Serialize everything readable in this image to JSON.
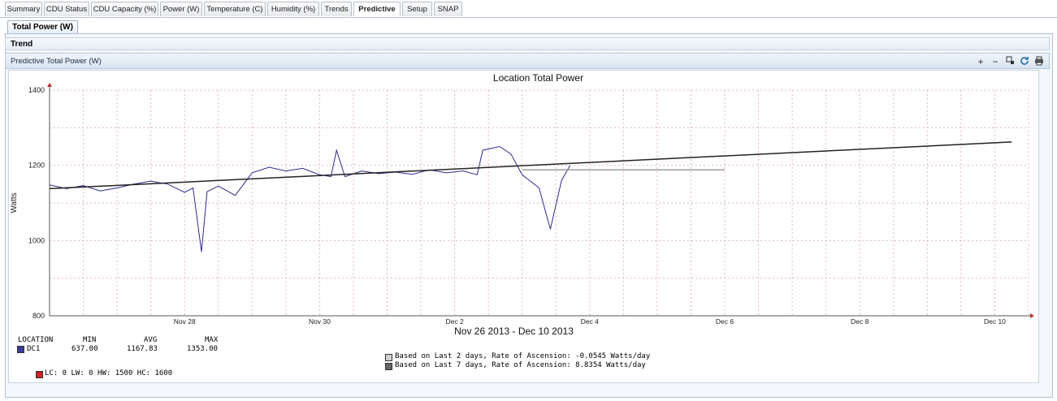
{
  "tabs": [
    {
      "label": "Summary",
      "active": false
    },
    {
      "label": "CDU Status",
      "active": false
    },
    {
      "label": "CDU Capacity (%)",
      "active": false
    },
    {
      "label": "Power (W)",
      "active": false
    },
    {
      "label": "Temperature (C)",
      "active": false
    },
    {
      "label": "Humidity (%)",
      "active": false
    },
    {
      "label": "Trends",
      "active": false
    },
    {
      "label": "Predictive",
      "active": true
    },
    {
      "label": "Setup",
      "active": false
    },
    {
      "label": "SNAP",
      "active": false
    }
  ],
  "subtab": {
    "label": "Total Power (W)"
  },
  "section": {
    "title": "Trend"
  },
  "panel": {
    "title": "Predictive Total Power (W)",
    "toolbar": [
      "zoom-in-icon",
      "zoom-out-icon",
      "zoom-fit-icon",
      "refresh-icon",
      "print-icon"
    ]
  },
  "chart_data": {
    "type": "line",
    "title": "Location Total Power",
    "xlabel": "Nov 26 2013 - Dec 10 2013",
    "ylabel": "Watts",
    "ylim": [
      800,
      1400
    ],
    "yticks": [
      "800",
      "1000",
      "1200",
      "1400"
    ],
    "xlim": [
      "2013-11-26",
      "2013-12-10"
    ],
    "xticks": [
      "Nov 28",
      "Nov 30",
      "Dec 2",
      "Dec 4",
      "Dec 6",
      "Dec 8",
      "Dec 10"
    ],
    "grid": true,
    "series": [
      {
        "name": "DC1",
        "color": "#2b2b8c",
        "points": [
          [
            "2013-11-26T00:00",
            1148
          ],
          [
            "2013-11-26T06:00",
            1138
          ],
          [
            "2013-11-26T12:00",
            1146
          ],
          [
            "2013-11-26T18:00",
            1132
          ],
          [
            "2013-11-27T00:00",
            1140
          ],
          [
            "2013-11-27T06:00",
            1150
          ],
          [
            "2013-11-27T12:00",
            1158
          ],
          [
            "2013-11-27T18:00",
            1150
          ],
          [
            "2013-11-28T00:00",
            1128
          ],
          [
            "2013-11-28T03:00",
            1140
          ],
          [
            "2013-11-28T06:00",
            970
          ],
          [
            "2013-11-28T08:00",
            1130
          ],
          [
            "2013-11-28T12:00",
            1145
          ],
          [
            "2013-11-28T18:00",
            1120
          ],
          [
            "2013-11-29T00:00",
            1180
          ],
          [
            "2013-11-29T06:00",
            1195
          ],
          [
            "2013-11-29T12:00",
            1185
          ],
          [
            "2013-11-29T18:00",
            1192
          ],
          [
            "2013-11-30T00:00",
            1175
          ],
          [
            "2013-11-30T04:00",
            1170
          ],
          [
            "2013-11-30T06:00",
            1240
          ],
          [
            "2013-11-30T09:00",
            1170
          ],
          [
            "2013-11-30T15:00",
            1185
          ],
          [
            "2013-11-30T21:00",
            1178
          ],
          [
            "2013-12-01T03:00",
            1182
          ],
          [
            "2013-12-01T09:00",
            1176
          ],
          [
            "2013-12-01T15:00",
            1188
          ],
          [
            "2013-12-01T21:00",
            1180
          ],
          [
            "2013-12-02T03:00",
            1185
          ],
          [
            "2013-12-02T08:00",
            1175
          ],
          [
            "2013-12-02T10:00",
            1240
          ],
          [
            "2013-12-02T16:00",
            1250
          ],
          [
            "2013-12-02T20:00",
            1230
          ],
          [
            "2013-12-03T00:00",
            1175
          ],
          [
            "2013-12-03T06:00",
            1140
          ],
          [
            "2013-12-03T10:00",
            1030
          ],
          [
            "2013-12-03T14:00",
            1160
          ],
          [
            "2013-12-03T17:00",
            1200
          ]
        ]
      },
      {
        "name": "Based on Last 2 days",
        "color": "#9a9a9a",
        "points": [
          [
            "2013-12-03T00:00",
            1188
          ],
          [
            "2013-12-06T00:00",
            1188
          ]
        ]
      },
      {
        "name": "Based on Last 7 days",
        "color": "#222222",
        "points": [
          [
            "2013-11-26T00:00",
            1138
          ],
          [
            "2013-12-10T06:00",
            1262
          ]
        ]
      }
    ],
    "stats": {
      "headers": [
        "LOCATION",
        "MIN",
        "AVG",
        "MAX"
      ],
      "rows": [
        {
          "location": "DC1",
          "min": "637.00",
          "avg": "1167.83",
          "max": "1353.00",
          "color": "#3a3a9a"
        }
      ]
    },
    "projections": [
      {
        "text": "Based on Last 2 days, Rate of Ascension: -0.0545 Watts/day",
        "color": "#d0d0d0"
      },
      {
        "text": "Based on Last 7 days, Rate of Ascension: 8.8354 Watts/day",
        "color": "#666666"
      }
    ],
    "thresholds": {
      "text": "LC: 0 LW: 0 HW: 1500 HC: 1600",
      "color": "#cc2222"
    }
  }
}
